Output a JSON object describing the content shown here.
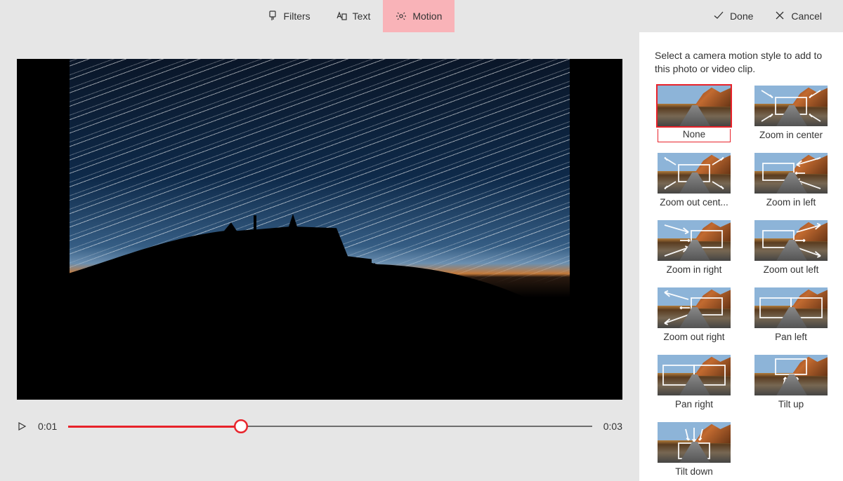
{
  "toolbar": {
    "tabs": [
      {
        "id": "filters",
        "label": "Filters",
        "active": false
      },
      {
        "id": "text",
        "label": "Text",
        "active": false
      },
      {
        "id": "motion",
        "label": "Motion",
        "active": true
      }
    ],
    "done_label": "Done",
    "cancel_label": "Cancel"
  },
  "playback": {
    "current_time": "0:01",
    "total_time": "0:03",
    "progress_percent": 33
  },
  "panel": {
    "description": "Select a camera motion style to add to this photo or video clip.",
    "selected_index": 0,
    "motions": [
      {
        "label": "None",
        "overlay": "none"
      },
      {
        "label": "Zoom in center",
        "overlay": "zoom-in-center"
      },
      {
        "label": "Zoom out cent...",
        "overlay": "zoom-out-center"
      },
      {
        "label": "Zoom in left",
        "overlay": "zoom-in-left"
      },
      {
        "label": "Zoom in right",
        "overlay": "zoom-in-right"
      },
      {
        "label": "Zoom out left",
        "overlay": "zoom-out-left"
      },
      {
        "label": "Zoom out right",
        "overlay": "zoom-out-right"
      },
      {
        "label": "Pan left",
        "overlay": "pan-left"
      },
      {
        "label": "Pan right",
        "overlay": "pan-right"
      },
      {
        "label": "Tilt up",
        "overlay": "tilt-up"
      },
      {
        "label": "Tilt down",
        "overlay": "tilt-down"
      }
    ]
  },
  "colors": {
    "accent": "#e8222a",
    "tab_active_bg": "#f9b3b8"
  }
}
